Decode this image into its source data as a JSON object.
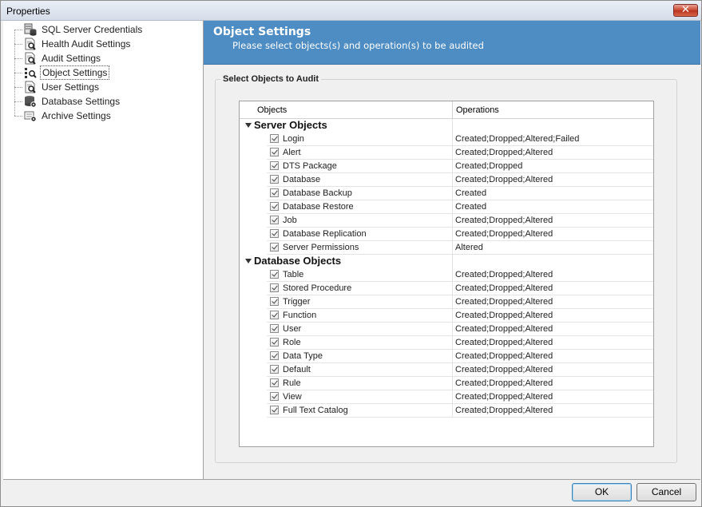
{
  "window": {
    "title": "Properties",
    "close_glyph": "✕"
  },
  "sidebar": {
    "items": [
      {
        "label": "SQL Server Credentials",
        "icon": "server-db-icon"
      },
      {
        "label": "Health Audit Settings",
        "icon": "page-search-icon"
      },
      {
        "label": "Audit Settings",
        "icon": "page-search-icon"
      },
      {
        "label": "Object Settings",
        "icon": "objects-search-icon",
        "selected": true
      },
      {
        "label": "User Settings",
        "icon": "page-search-icon"
      },
      {
        "label": "Database Settings",
        "icon": "db-gear-icon"
      },
      {
        "label": "Archive Settings",
        "icon": "archive-gear-icon"
      }
    ]
  },
  "banner": {
    "title": "Object Settings",
    "subtitle": "Please select objects(s) and operation(s) to be audited"
  },
  "group": {
    "label": "Select Objects to Audit"
  },
  "grid": {
    "columns": [
      "Objects",
      "Operations"
    ],
    "groups": [
      {
        "title": "Server Objects",
        "rows": [
          {
            "name": "Login",
            "ops": "Created;Dropped;Altered;Failed",
            "checked": true
          },
          {
            "name": "Alert",
            "ops": "Created;Dropped;Altered",
            "checked": true
          },
          {
            "name": "DTS Package",
            "ops": "Created;Dropped",
            "checked": true
          },
          {
            "name": "Database",
            "ops": "Created;Dropped;Altered",
            "checked": true
          },
          {
            "name": "Database Backup",
            "ops": "Created",
            "checked": true
          },
          {
            "name": "Database Restore",
            "ops": "Created",
            "checked": true
          },
          {
            "name": "Job",
            "ops": "Created;Dropped;Altered",
            "checked": true
          },
          {
            "name": "Database Replication",
            "ops": "Created;Dropped;Altered",
            "checked": true
          },
          {
            "name": "Server Permissions",
            "ops": "Altered",
            "checked": true
          }
        ]
      },
      {
        "title": "Database Objects",
        "rows": [
          {
            "name": "Table",
            "ops": "Created;Dropped;Altered",
            "checked": true
          },
          {
            "name": "Stored Procedure",
            "ops": "Created;Dropped;Altered",
            "checked": true
          },
          {
            "name": "Trigger",
            "ops": "Created;Dropped;Altered",
            "checked": true
          },
          {
            "name": "Function",
            "ops": "Created;Dropped;Altered",
            "checked": true
          },
          {
            "name": "User",
            "ops": "Created;Dropped;Altered",
            "checked": true
          },
          {
            "name": "Role",
            "ops": "Created;Dropped;Altered",
            "checked": true
          },
          {
            "name": "Data Type",
            "ops": "Created;Dropped;Altered",
            "checked": true
          },
          {
            "name": "Default",
            "ops": "Created;Dropped;Altered",
            "checked": true
          },
          {
            "name": "Rule",
            "ops": "Created;Dropped;Altered",
            "checked": true
          },
          {
            "name": "View",
            "ops": "Created;Dropped;Altered",
            "checked": true
          },
          {
            "name": "Full Text Catalog",
            "ops": "Created;Dropped;Altered",
            "checked": true
          }
        ]
      }
    ]
  },
  "buttons": {
    "ok": "OK",
    "cancel": "Cancel"
  },
  "colors": {
    "banner": "#4e8cc4",
    "selection_border": "#555555"
  }
}
